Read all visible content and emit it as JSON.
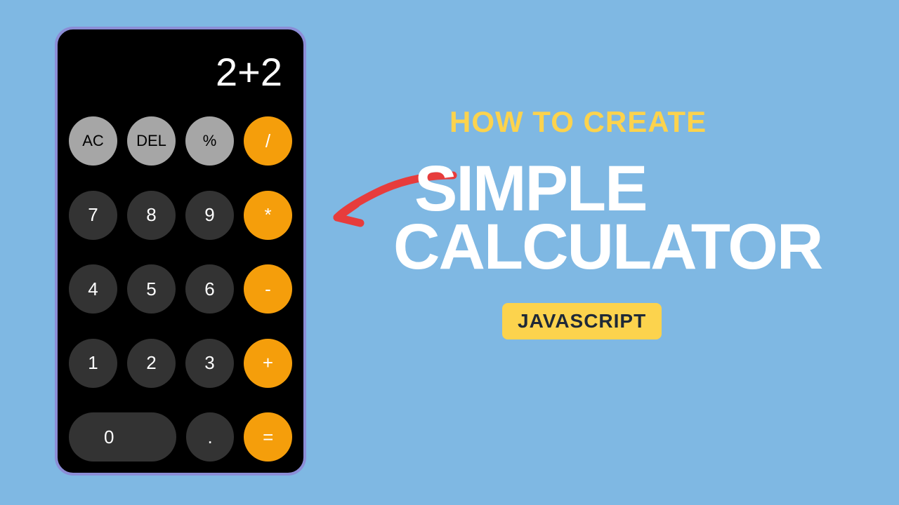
{
  "calculator": {
    "display_value": "2+2",
    "buttons": {
      "row1": [
        {
          "label": "AC",
          "type": "light-gray",
          "name": "clear-all-button"
        },
        {
          "label": "DEL",
          "type": "light-gray",
          "name": "delete-button"
        },
        {
          "label": "%",
          "type": "light-gray",
          "name": "percent-button"
        },
        {
          "label": "/",
          "type": "orange",
          "name": "divide-button"
        }
      ],
      "row2": [
        {
          "label": "7",
          "type": "dark-gray",
          "name": "digit-7-button"
        },
        {
          "label": "8",
          "type": "dark-gray",
          "name": "digit-8-button"
        },
        {
          "label": "9",
          "type": "dark-gray",
          "name": "digit-9-button"
        },
        {
          "label": "*",
          "type": "orange",
          "name": "multiply-button"
        }
      ],
      "row3": [
        {
          "label": "4",
          "type": "dark-gray",
          "name": "digit-4-button"
        },
        {
          "label": "5",
          "type": "dark-gray",
          "name": "digit-5-button"
        },
        {
          "label": "6",
          "type": "dark-gray",
          "name": "digit-6-button"
        },
        {
          "label": "-",
          "type": "orange",
          "name": "subtract-button"
        }
      ],
      "row4": [
        {
          "label": "1",
          "type": "dark-gray",
          "name": "digit-1-button"
        },
        {
          "label": "2",
          "type": "dark-gray",
          "name": "digit-2-button"
        },
        {
          "label": "3",
          "type": "dark-gray",
          "name": "digit-3-button"
        },
        {
          "label": "+",
          "type": "orange",
          "name": "add-button"
        }
      ],
      "row5": [
        {
          "label": "0",
          "type": "dark-gray wide",
          "name": "digit-0-button"
        },
        {
          "label": ".",
          "type": "dark-gray",
          "name": "decimal-button"
        },
        {
          "label": "=",
          "type": "orange",
          "name": "equals-button"
        }
      ]
    }
  },
  "headline": {
    "line1": "HOW TO CREATE",
    "line2_a": "SIMPLE",
    "line2_b": "CALCULATOR",
    "tag": "JAVASCRIPT"
  },
  "colors": {
    "background": "#7fb8e3",
    "accent_yellow": "#fcd34d",
    "accent_orange": "#f59e0b",
    "arrow_red": "#e73c3c"
  }
}
